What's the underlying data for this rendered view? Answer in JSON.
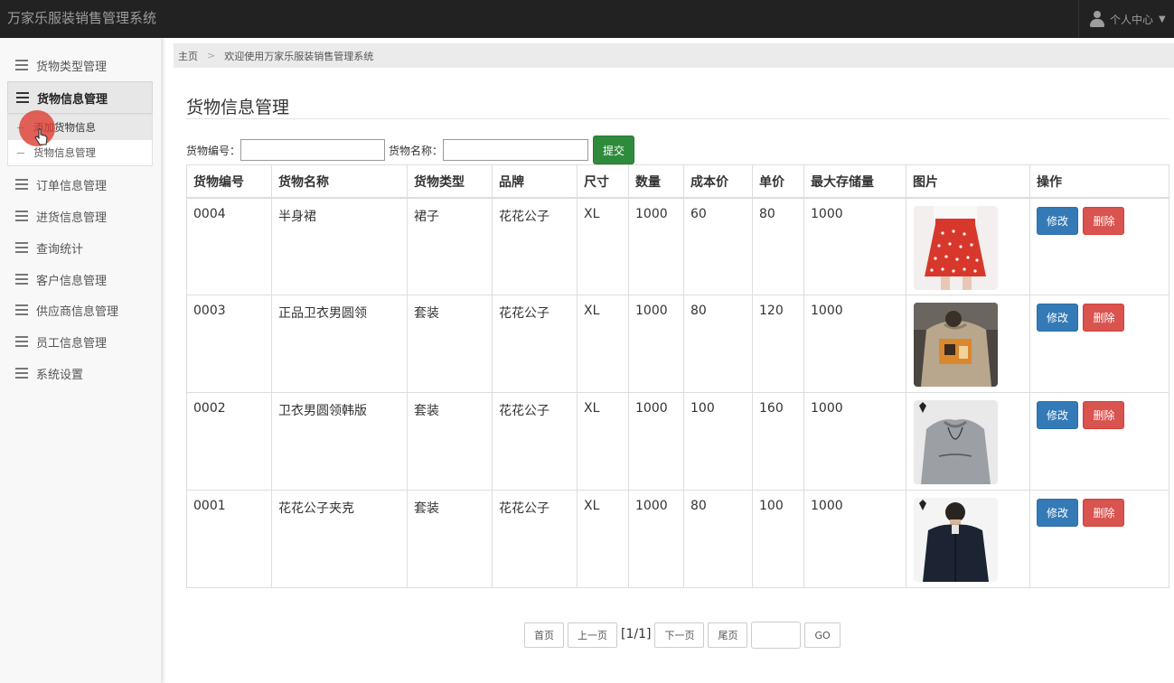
{
  "app": {
    "title": "万家乐服装销售管理系统"
  },
  "user_menu": {
    "label": "个人中心",
    "icon": "user-icon"
  },
  "sidebar": {
    "items": [
      {
        "label": "货物类型管理"
      },
      {
        "label": "货物信息管理",
        "active": true
      },
      {
        "label": "订单信息管理"
      },
      {
        "label": "进货信息管理"
      },
      {
        "label": "查询统计"
      },
      {
        "label": "客户信息管理"
      },
      {
        "label": "供应商信息管理"
      },
      {
        "label": "员工信息管理"
      },
      {
        "label": "系统设置"
      }
    ],
    "subitems": [
      {
        "label": "添加货物信息",
        "active": true
      },
      {
        "label": "货物信息管理"
      }
    ]
  },
  "breadcrumb": {
    "home": "主页",
    "current": "欢迎使用万家乐服装销售管理系统"
  },
  "page": {
    "title": "货物信息管理"
  },
  "search": {
    "code_label": "货物编号：",
    "code_value": "",
    "name_label": "货物名称：",
    "name_value": "",
    "submit_label": "提交"
  },
  "table": {
    "headers": [
      "货物编号",
      "货物名称",
      "货物类型",
      "品牌",
      "尺寸",
      "数量",
      "成本价",
      "单价",
      "最大存储量",
      "图片",
      "操作"
    ],
    "rows": [
      {
        "code": "0004",
        "name": "半身裙",
        "type": "裙子",
        "brand": "花花公子",
        "size": "XL",
        "qty": "1000",
        "cost": "60",
        "price": "80",
        "max": "1000",
        "image": "red-polka-dot-skirt"
      },
      {
        "code": "0003",
        "name": "正品卫衣男圆领",
        "type": "套装",
        "brand": "花花公子",
        "size": "XL",
        "qty": "1000",
        "cost": "80",
        "price": "120",
        "max": "1000",
        "image": "khaki-graphic-sweatshirt"
      },
      {
        "code": "0002",
        "name": "卫衣男圆领韩版",
        "type": "套装",
        "brand": "花花公子",
        "size": "XL",
        "qty": "1000",
        "cost": "100",
        "price": "160",
        "max": "1000",
        "image": "grey-sweatshirt"
      },
      {
        "code": "0001",
        "name": "花花公子夹克",
        "type": "套装",
        "brand": "花花公子",
        "size": "XL",
        "qty": "1000",
        "cost": "80",
        "price": "100",
        "max": "1000",
        "image": "navy-jacket"
      }
    ],
    "edit_label": "修改",
    "delete_label": "删除"
  },
  "pager": {
    "first": "首页",
    "prev": "上一页",
    "info": "[1/1]",
    "next": "下一页",
    "last": "尾页",
    "go": "GO"
  },
  "colors": {
    "topbar": "#222222",
    "submit": "#2e8b3c",
    "edit": "#337ab7",
    "delete": "#d9534f"
  }
}
